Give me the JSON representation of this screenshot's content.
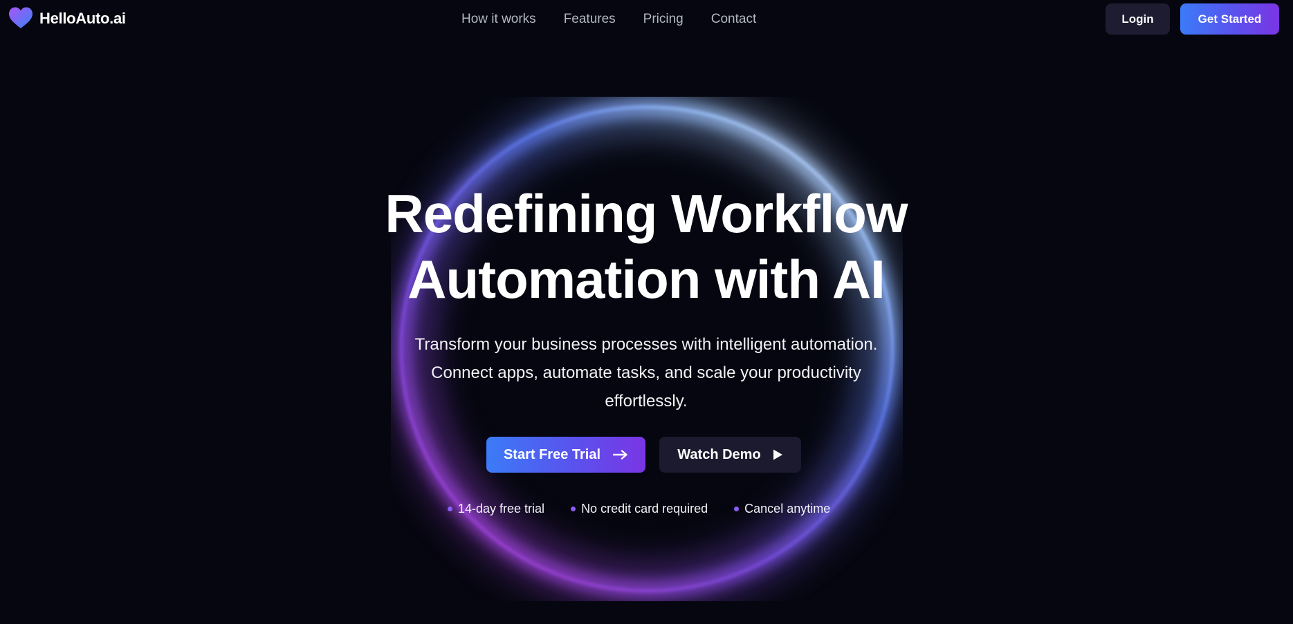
{
  "brand": {
    "name": "HelloAuto.ai",
    "icon": "heart-icon",
    "gradient_start": "#3b82f6",
    "gradient_end": "#a855f7"
  },
  "nav": {
    "items": [
      {
        "label": "How it works"
      },
      {
        "label": "Features"
      },
      {
        "label": "Pricing"
      },
      {
        "label": "Contact"
      }
    ]
  },
  "header_actions": {
    "login_label": "Login",
    "get_started_label": "Get Started"
  },
  "hero": {
    "headline_line1": "Redefining Workflow",
    "headline_line2": "Automation with AI",
    "subtitle_line1": "Transform your business processes with intelligent automation.",
    "subtitle_line2": "Connect apps, automate tasks, and scale your productivity",
    "subtitle_line3": "effortlessly.",
    "primary_cta": {
      "label": "Start Free Trial",
      "icon": "arrow-right-icon"
    },
    "secondary_cta": {
      "label": "Watch Demo",
      "icon": "play-icon"
    },
    "perks": [
      {
        "label": "14-day free trial"
      },
      {
        "label": "No credit card required"
      },
      {
        "label": "Cancel anytime"
      }
    ]
  },
  "colors": {
    "background": "#05060f",
    "accent_blue": "#3b7bf7",
    "accent_purple": "#7a35e4",
    "perk_dot": "#8b5cf6",
    "secondary_button": "#1b1a2e"
  }
}
